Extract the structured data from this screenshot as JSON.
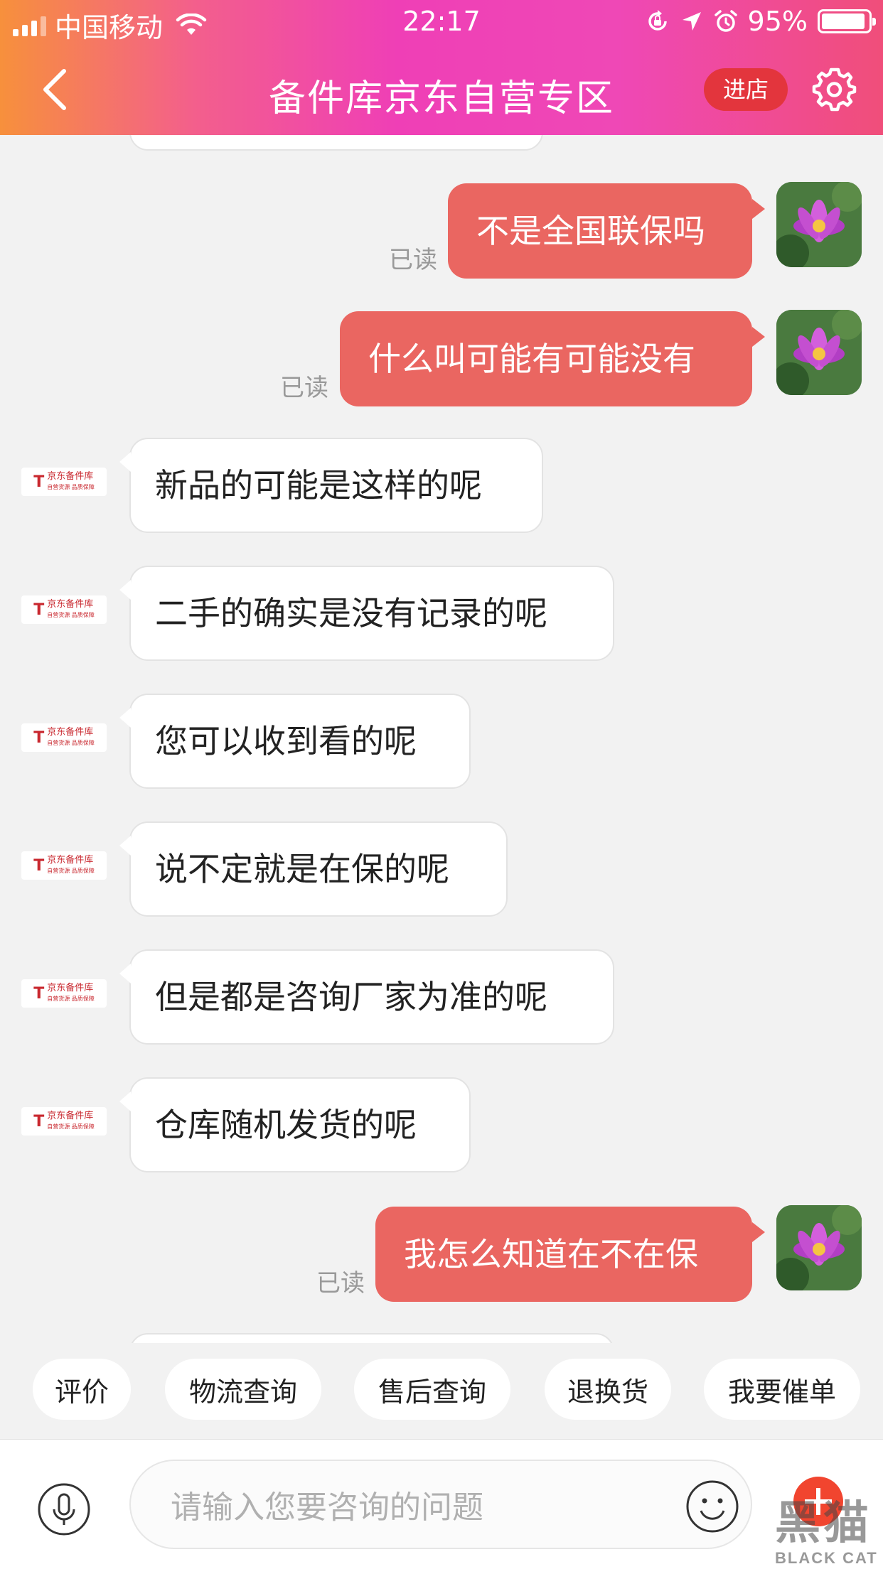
{
  "status_bar": {
    "carrier": "中国移动",
    "time": "22:17",
    "battery": "95%"
  },
  "nav": {
    "title": "备件库京东自营专区",
    "store_button": "进店"
  },
  "chat": {
    "read_label": "已读",
    "store_avatar": {
      "name": "京东备件库",
      "tagline": "自营货源 品质保障"
    },
    "messages": [
      {
        "from": "user",
        "text": "不是全国联保吗",
        "read": true
      },
      {
        "from": "user",
        "text": "什么叫可能有可能没有",
        "read": true
      },
      {
        "from": "store",
        "text": "新品的可能是这样的呢"
      },
      {
        "from": "store",
        "text": "二手的确实是没有记录的呢"
      },
      {
        "from": "store",
        "text": "您可以收到看的呢"
      },
      {
        "from": "store",
        "text": "说不定就是在保的呢"
      },
      {
        "from": "store",
        "text": "但是都是咨询厂家为准的呢"
      },
      {
        "from": "store",
        "text": "仓库随机发货的呢"
      },
      {
        "from": "user",
        "text": "我怎么知道在不在保",
        "read": true
      }
    ]
  },
  "quick_actions": [
    "评价",
    "物流查询",
    "售后查询",
    "退换货",
    "我要催单"
  ],
  "input": {
    "placeholder": "请输入您要咨询的问题"
  },
  "watermark": {
    "main": "黑猫",
    "sub": "BLACK CAT"
  },
  "colors": {
    "user_bubble": "#ea6661",
    "store_button": "#e3353d",
    "plus_button": "#f1452f"
  }
}
